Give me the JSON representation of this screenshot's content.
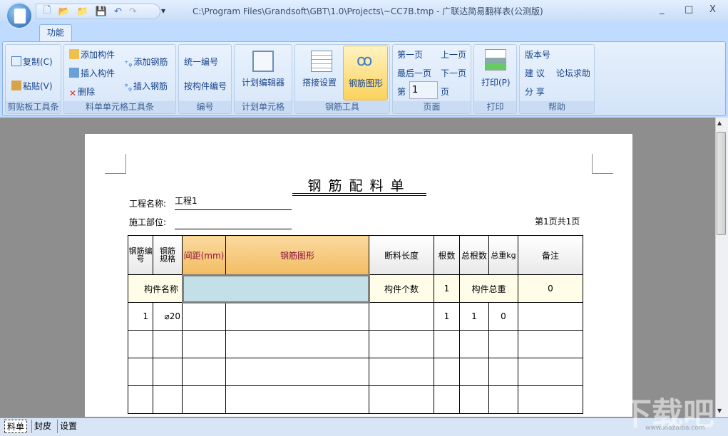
{
  "window": {
    "title": "C:\\Program Files\\Grandsoft\\GBT\\1.0\\Projects\\~CC7B.tmp - 广联达简易翻样表(公测版)",
    "minimize": "_",
    "maximize": "□",
    "close": "X"
  },
  "ribbon": {
    "tab": "功能",
    "clipboard": {
      "copy": "复制(C)",
      "paste": "粘贴(V)",
      "label": "剪贴板工具条"
    },
    "cell": {
      "add_component": "添加构件",
      "insert_component": "插入构件",
      "delete": "删除",
      "add_rebar": "添加钢筋",
      "insert_rebar": "插入钢筋",
      "label": "料单单元格工具条"
    },
    "numbering": {
      "unified": "统一编号",
      "by_component": "按构件编号",
      "label": "编号"
    },
    "plan": {
      "editor": "计划编辑器",
      "label": "计划单元格"
    },
    "rebar_tools": {
      "lap": "搭接设置",
      "shape": "钢筋图形",
      "label": "钢筋工具"
    },
    "page": {
      "first": "第一页",
      "prev": "上一页",
      "last": "最后一页",
      "next": "下一页",
      "page_prefix": "第",
      "page_value": "1",
      "page_suffix": "页",
      "label": "页面"
    },
    "print": {
      "print": "打印(P)",
      "label": "打印"
    },
    "help": {
      "version": "版本号",
      "suggest": "建 议",
      "forum": "论坛求助",
      "share": "分 享",
      "label": "帮助"
    }
  },
  "doc": {
    "title": "钢筋配料单",
    "project_label": "工程名称:",
    "project_value": "工程1",
    "location_label": "施工部位:",
    "location_value": "",
    "page_info": "第1页共1页",
    "headers": [
      "钢筋编号",
      "钢筋规格",
      "间距(mm)",
      "钢筋图形",
      "断料长度",
      "根数",
      "总根数",
      "总重kg",
      "备注"
    ],
    "component_row": {
      "name_label": "构件名称",
      "name_value": "",
      "count_label": "构件个数",
      "count_value": "1",
      "weight_label": "构件总重",
      "weight_value": "0"
    },
    "rows": [
      {
        "no": "1",
        "spec": "⌀20",
        "spacing": "",
        "shape": "",
        "length": "",
        "count": "1",
        "total": "1",
        "weight": "0",
        "note": ""
      }
    ]
  },
  "sheet_tabs": [
    "料单",
    "封皮",
    "设置"
  ],
  "watermark": "下载吧",
  "watermark_url": "www.xiazaiba.com"
}
